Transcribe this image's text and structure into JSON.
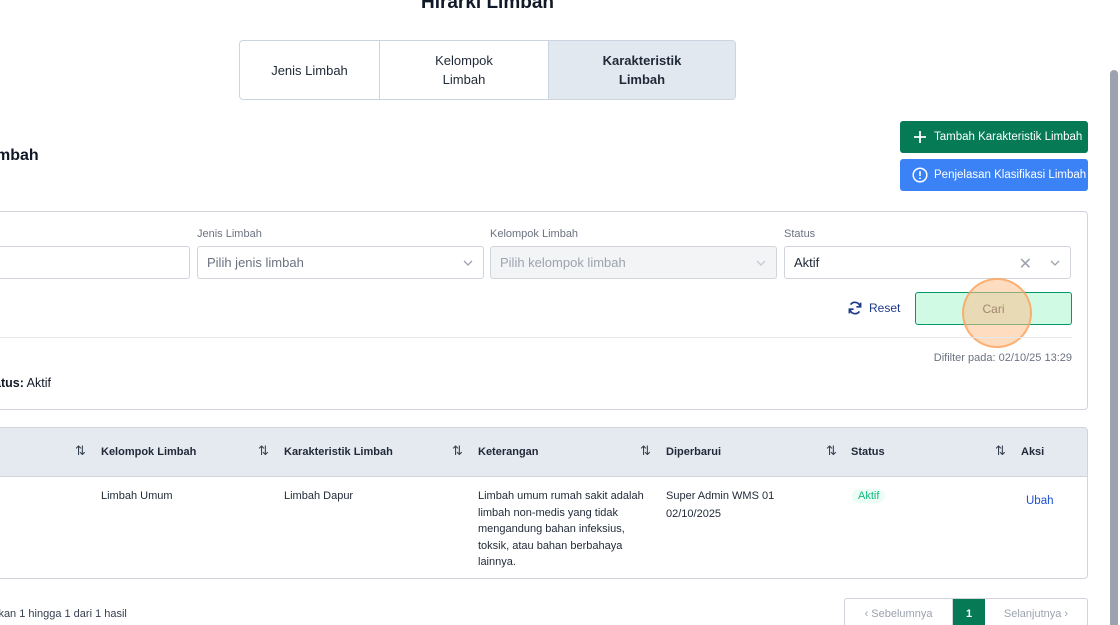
{
  "header": {
    "title": "Hirarki Limbah"
  },
  "tabs": [
    {
      "label": "Jenis Limbah"
    },
    {
      "label": "Kelompok Limbah"
    },
    {
      "label": "Karakteristik Limbah"
    }
  ],
  "section": {
    "title": "mbah"
  },
  "actions": {
    "add_label": "Tambah Karakteristik Limbah",
    "info_label": "Penjelasan Klasifikasi Limbah"
  },
  "filters": {
    "jenis": {
      "label": "Jenis Limbah",
      "placeholder": "Pilih jenis limbah"
    },
    "kelompok": {
      "label": "Kelompok Limbah",
      "placeholder": "Pilih kelompok limbah"
    },
    "status": {
      "label": "Status",
      "value": "Aktif"
    },
    "reset_label": "Reset",
    "search_label": "Cari",
    "filtered_at": "Difilter pada: 02/10/25 13:29",
    "summary_key": "atus:",
    "summary_value": "Aktif"
  },
  "table": {
    "headers": {
      "kelompok": "Kelompok Limbah",
      "karakteristik": "Karakteristik Limbah",
      "keterangan": "Keterangan",
      "diperbarui": "Diperbarui",
      "status": "Status",
      "aksi": "Aksi"
    },
    "rows": [
      {
        "kelompok": "Limbah Umum",
        "karakteristik": "Limbah Dapur",
        "keterangan_lines": [
          "Limbah umum rumah sakit adalah",
          "limbah non-medis yang tidak",
          "mengandung bahan infeksius,",
          "toksik, atau bahan berbahaya",
          "lainnya."
        ],
        "updated_by": "Super Admin WMS 01",
        "updated_date": "02/10/2025",
        "status": "Aktif",
        "action": "Ubah"
      }
    ]
  },
  "pagination": {
    "info": "lkan 1 hingga 1 dari 1 hasil",
    "prev": "‹  Sebelumnya",
    "current": "1",
    "next": "Selanjutnya  ›"
  },
  "colors": {
    "primary_green": "#057a55",
    "info_blue": "#3b82f6",
    "link_blue": "#1d4ed8"
  }
}
